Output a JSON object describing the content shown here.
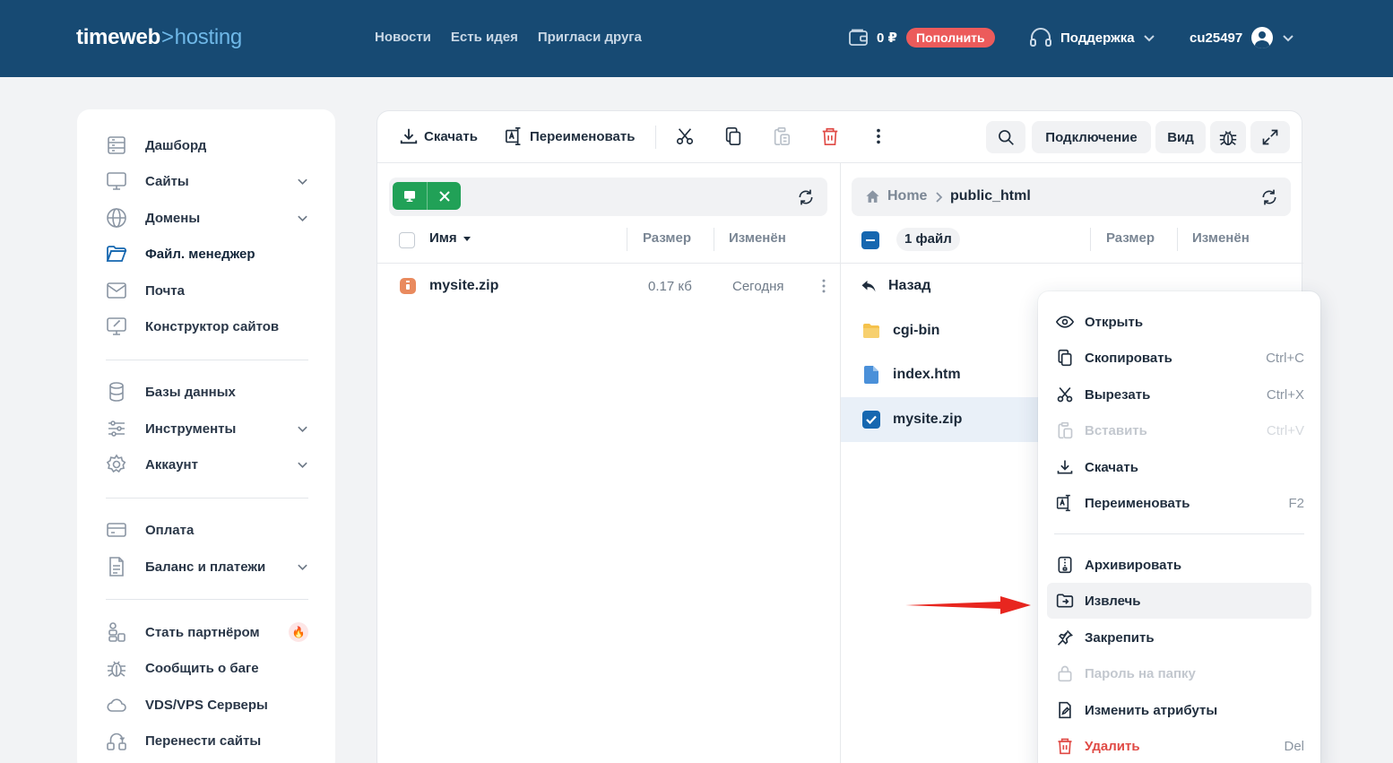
{
  "header": {
    "logo_main": "timeweb",
    "logo_sep": ">",
    "logo_sub": "hosting",
    "nav": [
      "Новости",
      "Есть идея",
      "Пригласи друга"
    ],
    "balance": "0 ₽",
    "topup_label": "Пополнить",
    "support_label": "Поддержка",
    "username": "cu25497"
  },
  "sidebar": {
    "items": [
      {
        "label": "Дашборд",
        "icon": "dashboard-icon"
      },
      {
        "label": "Сайты",
        "icon": "monitor-icon"
      },
      {
        "label": "Домены",
        "icon": "globe-icon"
      },
      {
        "label": "Файл. менеджер",
        "icon": "folder-icon"
      },
      {
        "label": "Почта",
        "icon": "mail-icon"
      },
      {
        "label": "Конструктор сайтов",
        "icon": "site-builder-icon"
      },
      {
        "label": "Базы данных",
        "icon": "database-icon"
      },
      {
        "label": "Инструменты",
        "icon": "sliders-icon"
      },
      {
        "label": "Аккаунт",
        "icon": "gear-icon"
      },
      {
        "label": "Оплата",
        "icon": "card-icon"
      },
      {
        "label": "Баланс и платежи",
        "icon": "document-icon"
      },
      {
        "label": "Стать партнёром",
        "icon": "partner-icon"
      },
      {
        "label": "Сообщить о баге",
        "icon": "bug-icon"
      },
      {
        "label": "VDS/VPS Серверы",
        "icon": "cloud-icon"
      },
      {
        "label": "Перенести сайты",
        "icon": "transfer-icon"
      }
    ]
  },
  "toolbar": {
    "download_label": "Скачать",
    "rename_label": "Переименовать",
    "connect_label": "Подключение",
    "view_label": "Вид"
  },
  "left_pane": {
    "col_name": "Имя",
    "col_size": "Размер",
    "col_modified": "Изменён",
    "files": [
      {
        "name": "mysite.zip",
        "size": "0.17 кб",
        "modified": "Сегодня"
      }
    ]
  },
  "right_pane": {
    "crumb_home": "Home",
    "crumb_folder": "public_html",
    "count_label": "1 файл",
    "col_size": "Размер",
    "col_modified": "Изменён",
    "back_label": "Назад",
    "files": [
      {
        "name": "cgi-bin",
        "type": "folder"
      },
      {
        "name": "index.htm",
        "type": "file"
      },
      {
        "name": "mysite.zip",
        "type": "file",
        "selected": true
      }
    ]
  },
  "context_menu": {
    "items": [
      {
        "label": "Открыть",
        "shortcut": ""
      },
      {
        "label": "Скопировать",
        "shortcut": "Ctrl+C"
      },
      {
        "label": "Вырезать",
        "shortcut": "Ctrl+X"
      },
      {
        "label": "Вставить",
        "shortcut": "Ctrl+V",
        "disabled": true
      },
      {
        "label": "Скачать",
        "shortcut": ""
      },
      {
        "label": "Переименовать",
        "shortcut": "F2"
      },
      {
        "label": "Архивировать",
        "shortcut": ""
      },
      {
        "label": "Извлечь",
        "shortcut": "",
        "hover": true
      },
      {
        "label": "Закрепить",
        "shortcut": ""
      },
      {
        "label": "Пароль на папку",
        "shortcut": "",
        "disabled": true
      },
      {
        "label": "Изменить атрибуты",
        "shortcut": ""
      },
      {
        "label": "Удалить",
        "shortcut": "Del",
        "danger": true
      }
    ]
  },
  "colors": {
    "header_bg": "#174a73",
    "accent": "#1667b0",
    "green": "#21a157",
    "danger": "#e04a45",
    "annotation_arrow": "#e8261f"
  }
}
